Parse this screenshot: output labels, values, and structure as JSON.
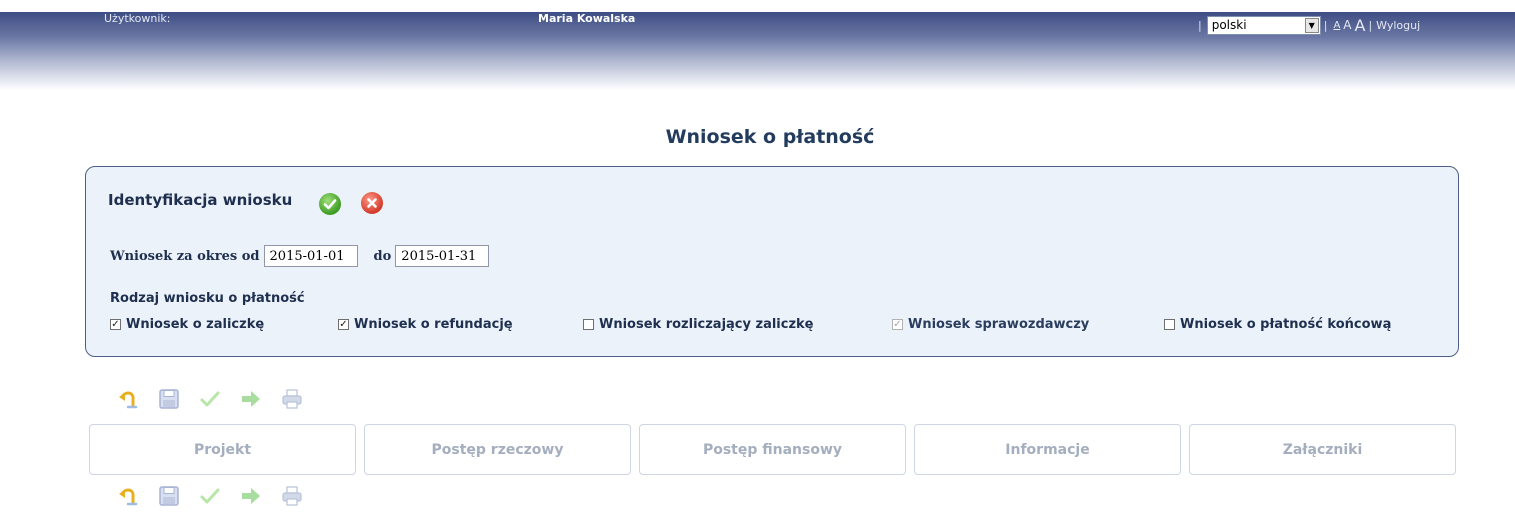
{
  "header": {
    "user_label": "Użytkownik:",
    "user_name": "Maria Kowalska",
    "language": "polski",
    "font_small": "A",
    "font_medium": "A",
    "font_large": "A",
    "logout": "Wyloguj"
  },
  "page_title": "Wniosek o płatność",
  "identification": {
    "title": "Identyfikacja wniosku",
    "period_label": "Wniosek za okres od",
    "to_label": "do",
    "date_from": "2015-01-01",
    "date_to": "2015-01-31",
    "type_label": "Rodzaj wniosku o płatność",
    "types": [
      {
        "label": "Wniosek o zaliczkę",
        "checked": true,
        "enabled": true
      },
      {
        "label": "Wniosek o refundację",
        "checked": true,
        "enabled": true
      },
      {
        "label": "Wniosek rozliczający zaliczkę",
        "checked": false,
        "enabled": true
      },
      {
        "label": "Wniosek sprawozdawczy",
        "checked": true,
        "enabled": false
      },
      {
        "label": "Wniosek o płatność końcową",
        "checked": false,
        "enabled": true
      }
    ]
  },
  "toolbar_icons": [
    "undo-icon",
    "save-icon",
    "check-icon",
    "forward-icon",
    "print-icon"
  ],
  "tabs": [
    {
      "label": "Projekt"
    },
    {
      "label": "Postęp rzeczowy"
    },
    {
      "label": "Postęp finansowy"
    },
    {
      "label": "Informacje"
    },
    {
      "label": "Załączniki"
    }
  ],
  "colors": {
    "panel_border": "#4d5f86",
    "panel_bg": "#ecf2f9",
    "title": "#233c5e",
    "tab_text": "#a4aebf"
  }
}
